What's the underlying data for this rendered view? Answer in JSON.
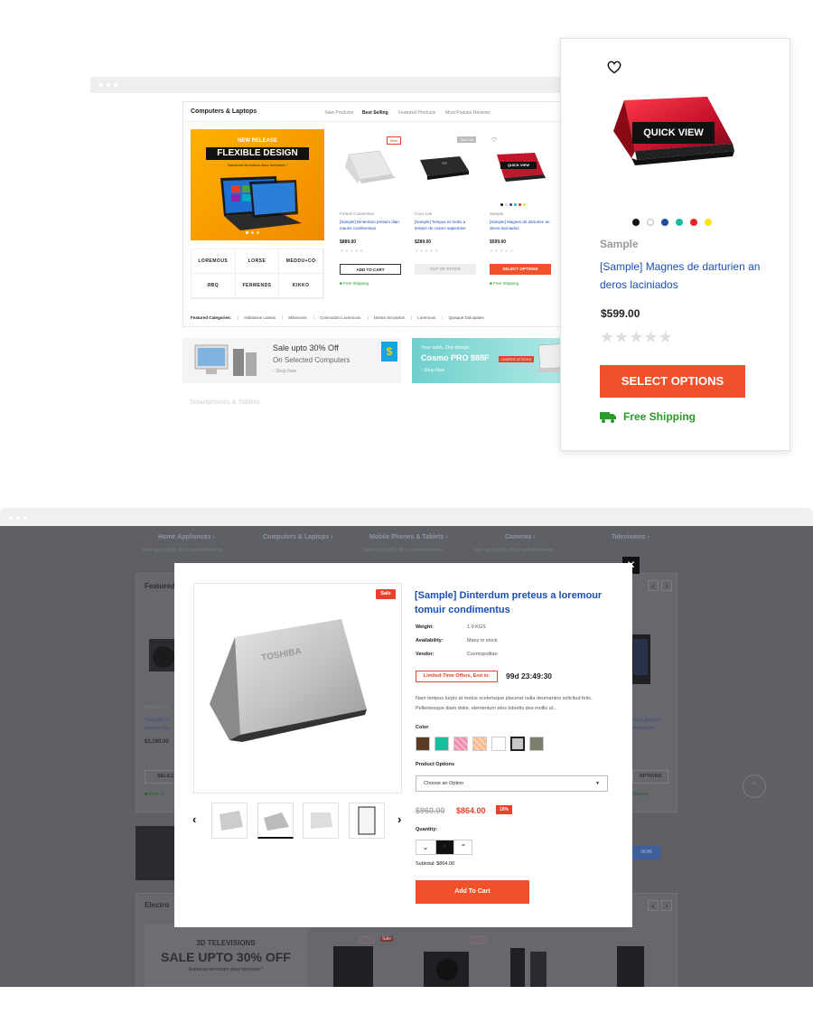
{
  "top_shop": {
    "section_title": "Computers & Laptops",
    "tabs": [
      "New Products",
      "Best Selling",
      "Featured Products",
      "Most Popular Reviews"
    ],
    "banner": {
      "tag": "NEW RELEASE",
      "headline": "FLEXIBLE DESIGN",
      "subline": "Nameove lemontum diour loremous *"
    },
    "brands": [
      "LOREMOUS",
      "LORSE",
      "MEDDU+CO",
      "ЯBQ",
      "FERMENDS",
      "KIKKO"
    ],
    "products": [
      {
        "badge": "New",
        "vendor": "French Connection",
        "title": "[Sample] Dinterdum pretium dian mauris condimentus",
        "price": "$889.00",
        "button": "ADD TO CART",
        "shipping": "Free Shipping"
      },
      {
        "badge": "Sold out",
        "vendor": "Coco Lee",
        "title": "[Sample] Tempus es loritis a tempor de cosmo sapiendos",
        "price": "$289.00",
        "button": "OUT OF STOCK",
        "shipping": ""
      },
      {
        "badge": "",
        "vendor": "Sample",
        "title": "[Sample] Magnes de darturien an deros laciniados",
        "price": "$599.00",
        "button": "SELECT OPTIONS",
        "shipping": "Free Shipping",
        "quick_view": "QUICK VIEW"
      }
    ],
    "featured_label": "Featured Categories:",
    "featured_categories": [
      "Habitasse Lateas",
      "Milanceos",
      "Cosmodum Lorennous",
      "Nostra Sinceptos",
      "Loremous",
      "Quisque Doluipates"
    ],
    "promo1": {
      "title": "Sale upto 30% Off",
      "subtitle": "On Selected Computers",
      "link": "Shop Now",
      "sticker": "$"
    },
    "promo2": {
      "small": "Your wish. Our design.",
      "title": "Cosmo PRO 988F",
      "tag": "LIMITED STOCKS",
      "link": "Shop Now"
    },
    "next_section": "Smartphones & Tablets"
  },
  "card": {
    "quick_view": "QUICK VIEW",
    "vendor": "Sample",
    "title": "[Sample] Magnes de darturien an deros laciniados",
    "price": "$599.00",
    "stars": "★★★★★",
    "button": "SELECT OPTIONS",
    "shipping": "Free Shipping",
    "swatch_colors": [
      "#111111",
      "#ffffff",
      "#1d4f9c",
      "#1fb8a6",
      "#e8262a",
      "#f7e51b"
    ]
  },
  "dark_page": {
    "nav": [
      {
        "label": "Home Appliances",
        "sub": "Sale up to 30% off on selected items"
      },
      {
        "label": "Computers & Laptops",
        "sub": ""
      },
      {
        "label": "Mobile Phones & Tablets",
        "sub": "Sale up to 30% off on selected items"
      },
      {
        "label": "Cameras",
        "sub": "Sale up to 25% off on selected items"
      },
      {
        "label": "Televisions",
        "sub": ""
      }
    ],
    "featured": "Featured",
    "electronics": "Electro",
    "left_vendor": "French Co",
    "left_title": "[Sample] Di dantes muu",
    "left_price": "$1,190.00",
    "left_btn": "SELEC",
    "left_ship": "Free S",
    "right_title": "ntian pretium dimentum",
    "right_btn": "OPTIONS",
    "right_ship": "hipping",
    "now_btn": "NOW",
    "tv_banner": {
      "top": "3D TELEVISIONS",
      "main": "SALE UPTO 30% OFF",
      "sub": "Nameove lemontum diour loremous *"
    },
    "bottom_badges": [
      "New",
      "Sale",
      "New"
    ]
  },
  "modal": {
    "close": "✕",
    "sale_badge": "Sale",
    "title": "[Sample] Dinterdum preteus a loremour tomuir condimentus",
    "weight_label": "Weight:",
    "weight": "1.9 KGS",
    "availability_label": "Availability:",
    "availability": "Many in stock",
    "vendor_label": "Vendor:",
    "vendor": "Cosmopolitan",
    "offer_label": "Limited-Time Offers, End in:",
    "timer": "99d 23:49:30",
    "description": "Nam tempus turpis at metus scelerisque placerat nulla deumantos solicitud felis. Pellentesque diam dolor, elementum etos lobortis des mollis ut...",
    "color_label": "Color",
    "colors": [
      "#5b3a26",
      "#1abc9c",
      "#f08cae",
      "#f7b98f",
      "#ffffff",
      "#c8c8c8",
      "#7d7d6e"
    ],
    "options_label": "Product Options",
    "option_selected": "Choose an Option",
    "old_price": "$960.00",
    "new_price": "$864.00",
    "discount": "10%",
    "quantity_label": "Quantity:",
    "quantity": "1",
    "subtotal": "Subtotal: $864.00",
    "add_to_cart": "Add To Cart"
  }
}
